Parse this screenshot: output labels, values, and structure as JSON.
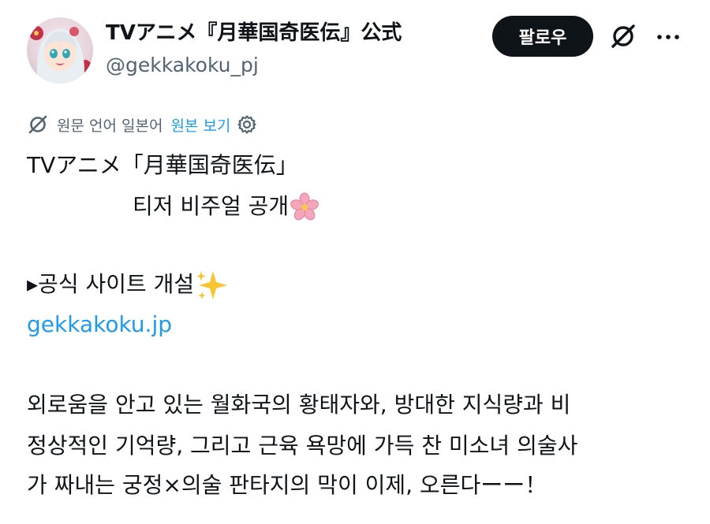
{
  "account": {
    "display_name": "TVアニメ『月華国奇医伝』公式",
    "handle": "@gekkakoku_pj",
    "avatar_icon": "anime-character-avatar"
  },
  "actions": {
    "follow_label": "팔로우",
    "grok_icon": "grok-icon",
    "more_icon": "more-options-icon"
  },
  "translation": {
    "note": "원문 언어 일본어",
    "show_original": "원본 보기",
    "settings_icon": "gear-icon"
  },
  "post": {
    "line1": "TVアニメ「月華国奇医伝」",
    "line2": "티저 비주얼 공개",
    "line2_emoji": "cherry-blossom",
    "line3": "▸공식 사이트 개설",
    "line3_emoji": "sparkles",
    "link": "gekkakoku.jp",
    "para1": "외로움을 안고 있는 월화국의 황태자와, 방대한 지식량과 비",
    "para2": "정상적인 기억량, 그리고 근육 욕망에 가득 찬 미소녀 의술사",
    "para3": "가 짜내는 궁정×의술 판타지의 막이 이제, 오른다ーー！"
  },
  "colors": {
    "text": "#0f1419",
    "secondary": "#536471",
    "link": "#1d9bf0",
    "button_bg": "#0f1419"
  }
}
